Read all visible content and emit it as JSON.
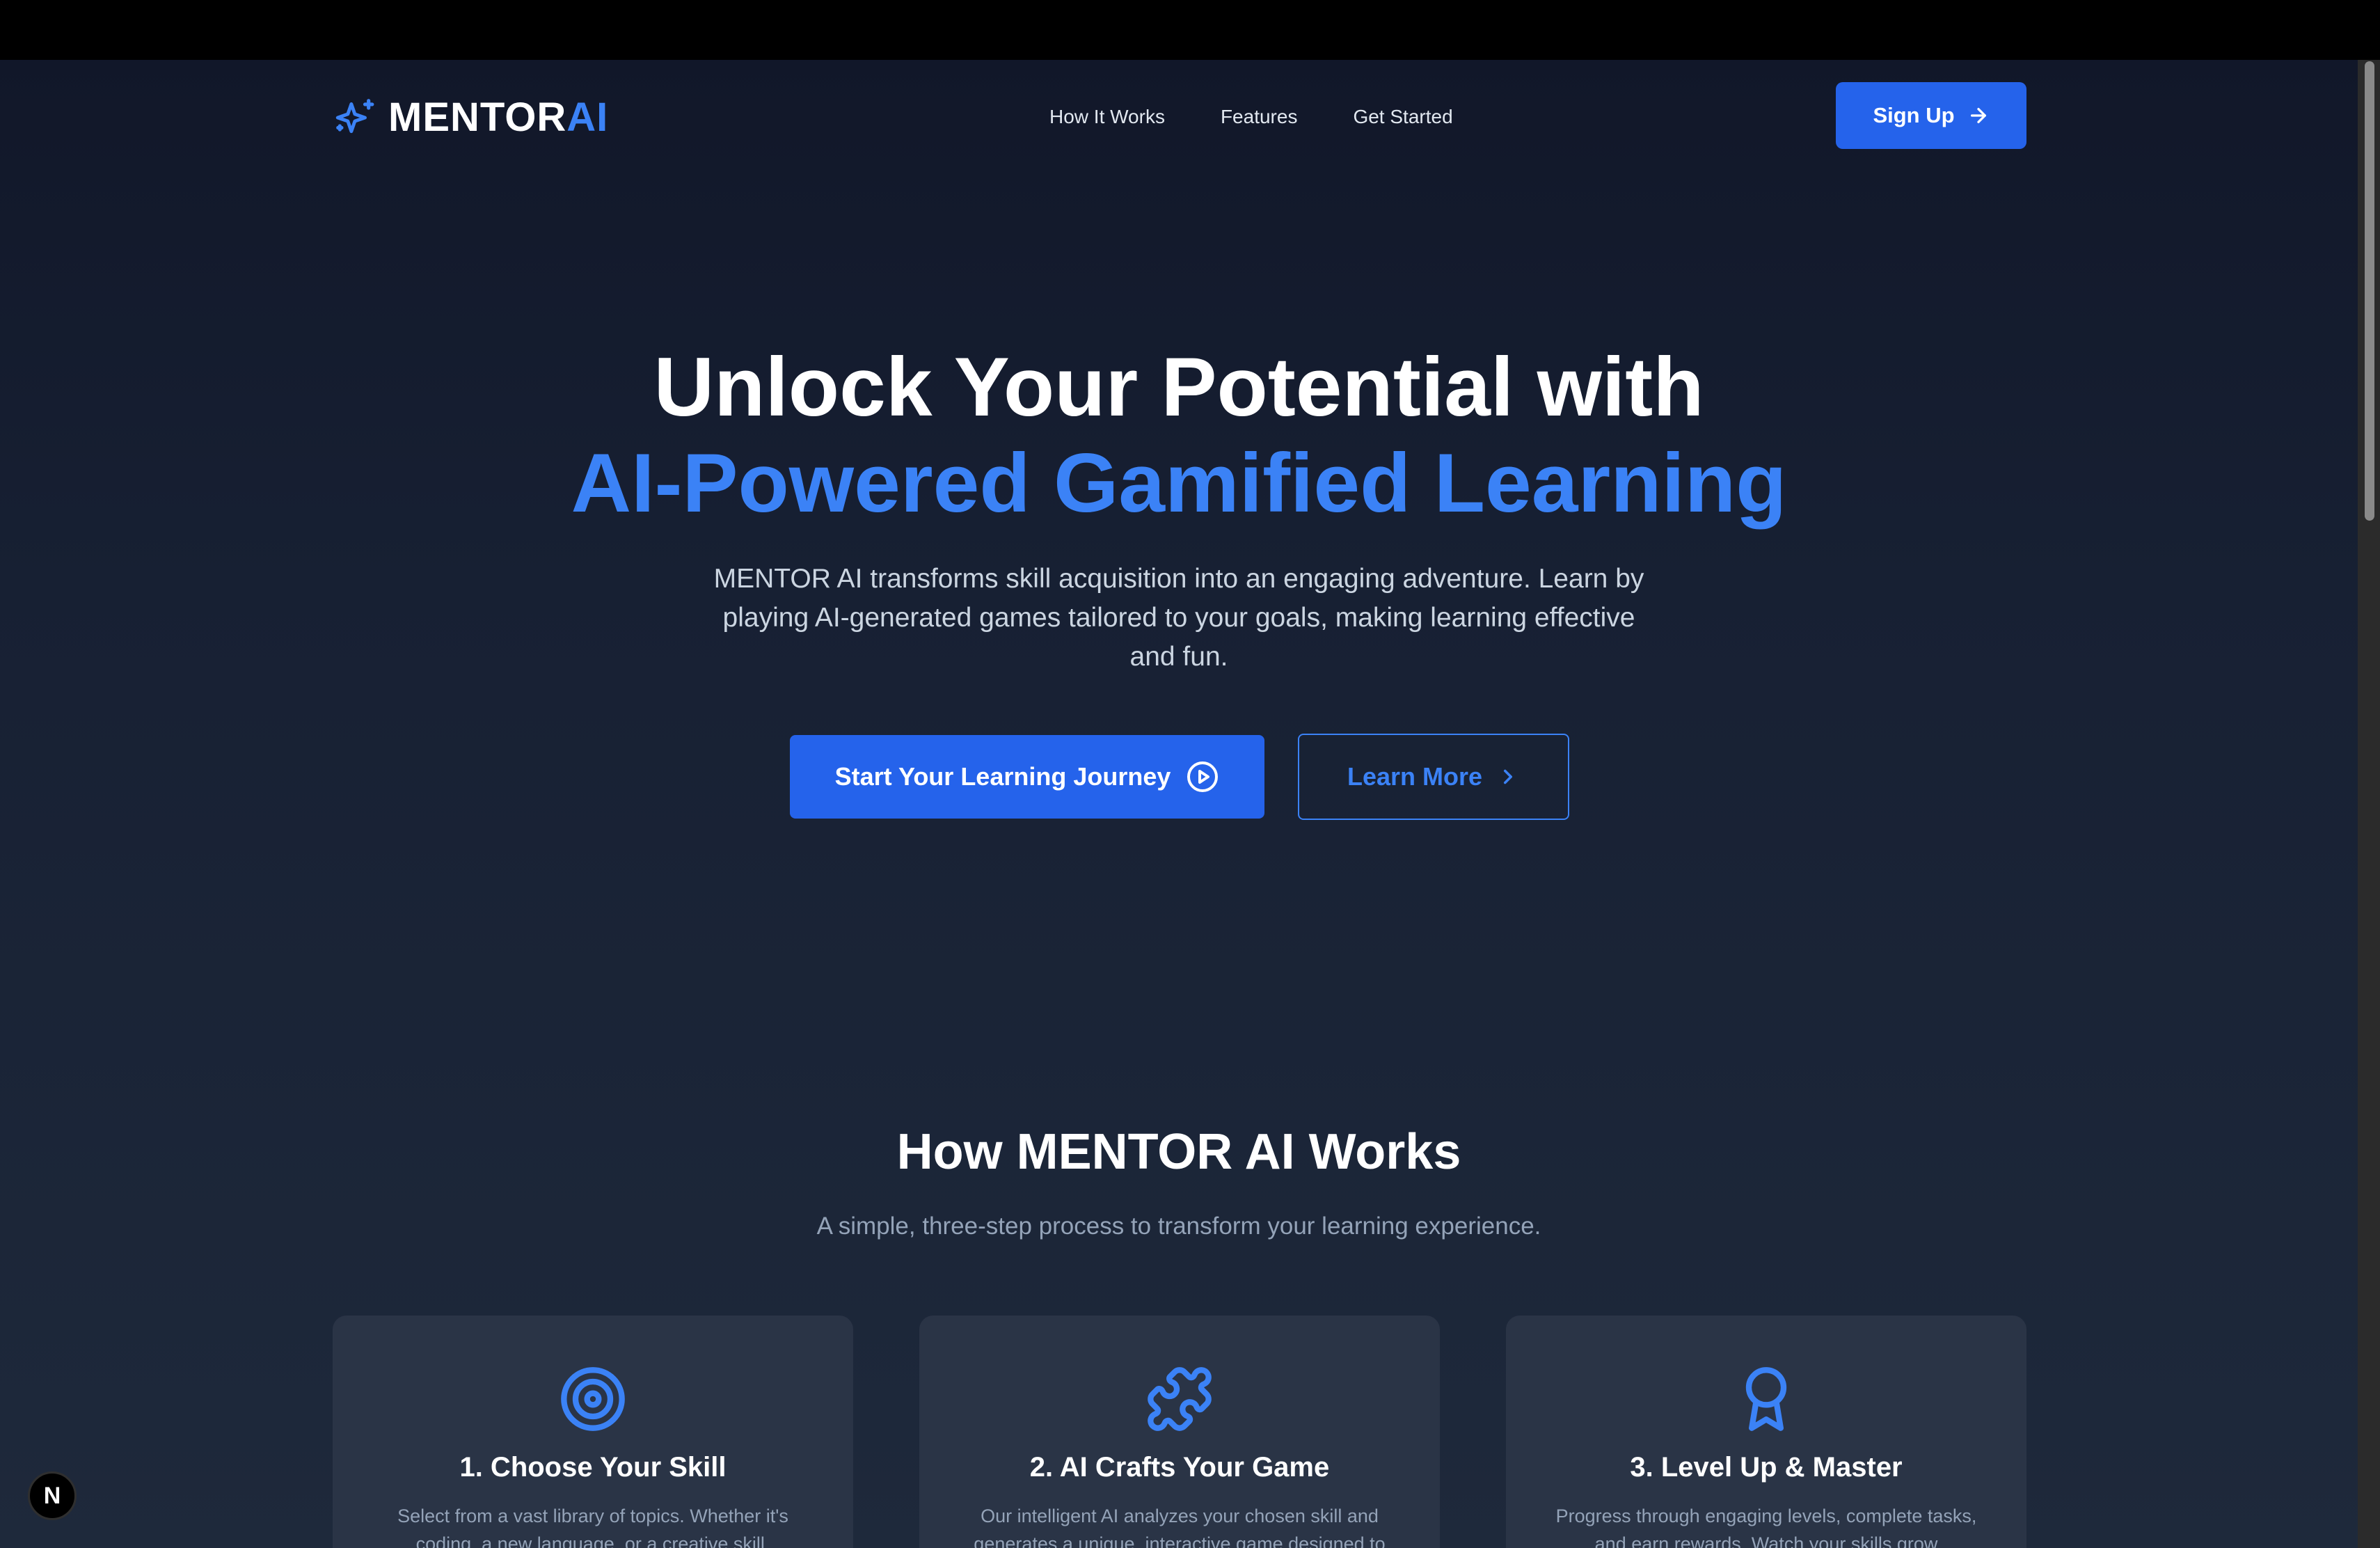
{
  "header": {
    "logo_main": "MENTOR",
    "logo_accent": "AI",
    "nav": [
      {
        "label": "How It Works"
      },
      {
        "label": "Features"
      },
      {
        "label": "Get Started"
      }
    ],
    "signup_label": "Sign Up"
  },
  "hero": {
    "title_line1": "Unlock Your Potential with",
    "title_line2": "AI-Powered Gamified Learning",
    "description": "MENTOR AI transforms skill acquisition into an engaging adventure. Learn by playing AI-generated games tailored to your goals, making learning effective and fun.",
    "primary_button": "Start Your Learning Journey",
    "secondary_button": "Learn More"
  },
  "how_it_works": {
    "title": "How MENTOR AI Works",
    "subtitle": "A simple, three-step process to transform your learning experience.",
    "steps": [
      {
        "icon": "target-icon",
        "title": "1. Choose Your Skill",
        "description": "Select from a vast library of topics. Whether it's coding, a new language, or a creative skill,"
      },
      {
        "icon": "puzzle-icon",
        "title": "2. AI Crafts Your Game",
        "description": "Our intelligent AI analyzes your chosen skill and generates a unique, interactive game designed to"
      },
      {
        "icon": "award-icon",
        "title": "3. Level Up & Master",
        "description": "Progress through engaging levels, complete tasks, and earn rewards. Watch your skills grow"
      }
    ]
  },
  "dev_badge": "N",
  "colors": {
    "accent": "#3b82f6",
    "button": "#2563eb",
    "background": "#111729",
    "card": "#2a3446"
  }
}
